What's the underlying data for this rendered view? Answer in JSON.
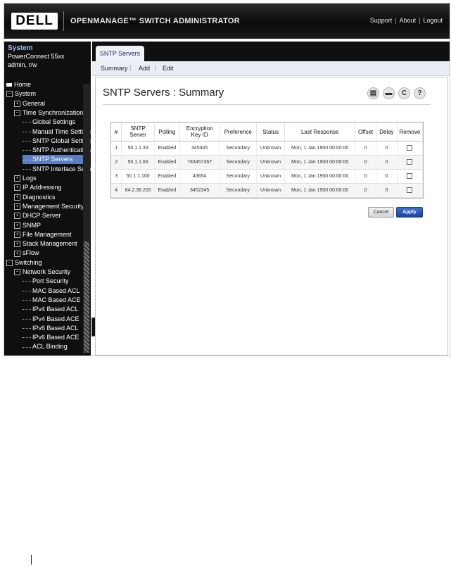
{
  "header": {
    "logo": "DELL",
    "app_title": "OPENMANAGE™ SWITCH ADMINISTRATOR",
    "links": [
      "Support",
      "About",
      "Logout"
    ]
  },
  "sidebar": {
    "system_title": "System",
    "model": "PowerConnect 55xx",
    "user": "admin, r/w",
    "tree": [
      {
        "label": "Home",
        "level": 0,
        "kind": "home"
      },
      {
        "label": "System",
        "level": 0,
        "kind": "minus"
      },
      {
        "label": "General",
        "level": 1,
        "kind": "plus"
      },
      {
        "label": "Time Synchronization",
        "level": 1,
        "kind": "minus"
      },
      {
        "label": "Global Settings",
        "level": 2,
        "kind": "leaf"
      },
      {
        "label": "Manual Time Settings",
        "level": 2,
        "kind": "leaf"
      },
      {
        "label": "SNTP Global Settings",
        "level": 2,
        "kind": "leaf"
      },
      {
        "label": "SNTP Authentication",
        "level": 2,
        "kind": "leaf"
      },
      {
        "label": "SNTP Servers",
        "level": 2,
        "kind": "leaf",
        "selected": true
      },
      {
        "label": "SNTP Interface Settings",
        "level": 2,
        "kind": "leaf"
      },
      {
        "label": "Logs",
        "level": 1,
        "kind": "plus"
      },
      {
        "label": "IP Addressing",
        "level": 1,
        "kind": "plus"
      },
      {
        "label": "Diagnostics",
        "level": 1,
        "kind": "plus"
      },
      {
        "label": "Management Security",
        "level": 1,
        "kind": "plus"
      },
      {
        "label": "DHCP Server",
        "level": 1,
        "kind": "plus"
      },
      {
        "label": "SNMP",
        "level": 1,
        "kind": "plus"
      },
      {
        "label": "File Management",
        "level": 1,
        "kind": "plus"
      },
      {
        "label": "Stack Management",
        "level": 1,
        "kind": "plus"
      },
      {
        "label": "sFlow",
        "level": 1,
        "kind": "plus"
      },
      {
        "label": "Switching",
        "level": 0,
        "kind": "minus"
      },
      {
        "label": "Network Security",
        "level": 1,
        "kind": "minus"
      },
      {
        "label": "Port Security",
        "level": 2,
        "kind": "leaf"
      },
      {
        "label": "MAC Based ACL",
        "level": 2,
        "kind": "leaf"
      },
      {
        "label": "MAC Based ACE",
        "level": 2,
        "kind": "leaf"
      },
      {
        "label": "IPv4 Based ACL",
        "level": 2,
        "kind": "leaf"
      },
      {
        "label": "IPv4 Based ACE",
        "level": 2,
        "kind": "leaf"
      },
      {
        "label": "IPv6 Based ACL",
        "level": 2,
        "kind": "leaf"
      },
      {
        "label": "IPv6 Based ACE",
        "level": 2,
        "kind": "leaf"
      },
      {
        "label": "ACL Binding",
        "level": 2,
        "kind": "leaf"
      }
    ]
  },
  "main": {
    "tab": "SNTP Servers",
    "subnav": [
      "Summary",
      "Add",
      "Edit"
    ],
    "page_title": "SNTP Servers : Summary",
    "toolbar_icons": [
      "save-icon",
      "print-icon",
      "refresh-icon",
      "help-icon"
    ],
    "table": {
      "headers": [
        "#",
        "SNTP Server",
        "Polling",
        "Encryption Key ID",
        "Preference",
        "Status",
        "Last Response",
        "Offset",
        "Delay",
        "Remove"
      ],
      "rows": [
        [
          "1",
          "50.1.1.33",
          "Enabled",
          "345345",
          "Secondary",
          "Unknown",
          "Mon, 1 Jan 1900 00:00:00",
          "0",
          "0"
        ],
        [
          "2",
          "50.1.1.66",
          "Enabled",
          "783467367",
          "Secondary",
          "Unknown",
          "Mon, 1 Jan 1900 00:00:00",
          "0",
          "0"
        ],
        [
          "3",
          "50.1.1.100",
          "Enabled",
          "43654",
          "Secondary",
          "Unknown",
          "Mon, 1 Jan 1900 00:00:00",
          "0",
          "0"
        ],
        [
          "4",
          "84.2.36.200",
          "Enabled",
          "3452345",
          "Secondary",
          "Unknown",
          "Mon, 1 Jan 1900 00:00:00",
          "0",
          "0"
        ]
      ]
    },
    "buttons": {
      "cancel": "Cancel",
      "apply": "Apply"
    }
  }
}
